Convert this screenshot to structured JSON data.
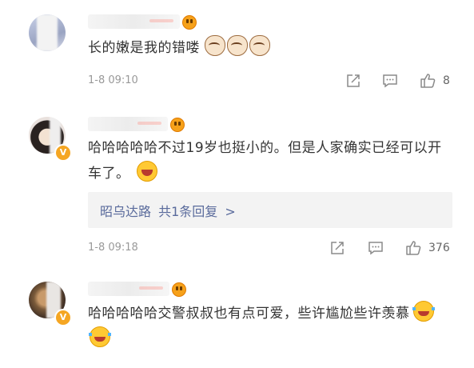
{
  "comments": [
    {
      "text": "长的嫩是我的错喽",
      "emojis": [
        "cat-emoji",
        "cat-emoji",
        "cat-emoji"
      ],
      "timestamp": "1-8 09:10",
      "likes": "8",
      "verified": false
    },
    {
      "text": "哈哈哈哈哈不过19岁也挺小的。但是人家确实已经可以开车了。",
      "emojis": [
        "laugh-emoji"
      ],
      "timestamp": "1-8 09:18",
      "likes": "376",
      "verified": true,
      "reply": {
        "user": "昭乌达路",
        "summary": "共1条回复",
        "arrow": ">"
      }
    },
    {
      "text": "哈哈哈哈哈交警叔叔也有点可爱，些许尴尬些许羡慕",
      "emojis": [
        "cry-laugh-emoji",
        "cry-laugh-emoji"
      ],
      "verified": false
    }
  ],
  "colors": {
    "text": "#333333",
    "meta": "#999999",
    "link": "#5a6b9c",
    "reply_bg": "#f3f3f3",
    "badge": "#f5a623"
  },
  "icons": [
    "share-icon",
    "comment-icon",
    "like-icon"
  ]
}
